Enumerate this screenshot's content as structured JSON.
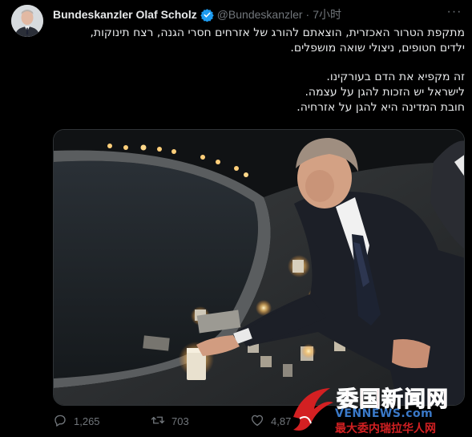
{
  "tweet": {
    "author_name": "Bundeskanzler Olaf Scholz",
    "handle": "@Bundeskanzler",
    "separator": "·",
    "timestamp": "7小时",
    "more_label": "···",
    "body_lines_para1": [
      "מתקפת הטרור האכזרית, הוצאתם להורג של אזרחים חסרי הגנה, רצח תינוקות,",
      "ילדים  חטופים, ניצולי שואה מושפלים."
    ],
    "body_lines_para2": [
      "זה מקפיא את הדם בעורקינו.",
      "לישראל יש הזכות להגן על עצמה.",
      "חובת המדינה היא להגן על אזרחיה."
    ],
    "stats": {
      "replies": "1,265",
      "retweets": "703",
      "likes": "4,87"
    }
  },
  "watermark": {
    "line1": "委国新闻网",
    "line2": "VENNEWS.com",
    "line3": "最大委内瑞拉华人网"
  },
  "colors": {
    "background": "#000000",
    "text": "#e7e9ea",
    "muted": "#71767b",
    "verified": "#1d9bf0",
    "watermark_red": "#d32022",
    "watermark_blue": "#3a79c8"
  },
  "icons": [
    "verified-badge-icon",
    "more-icon",
    "reply-icon",
    "retweet-icon",
    "like-icon"
  ]
}
